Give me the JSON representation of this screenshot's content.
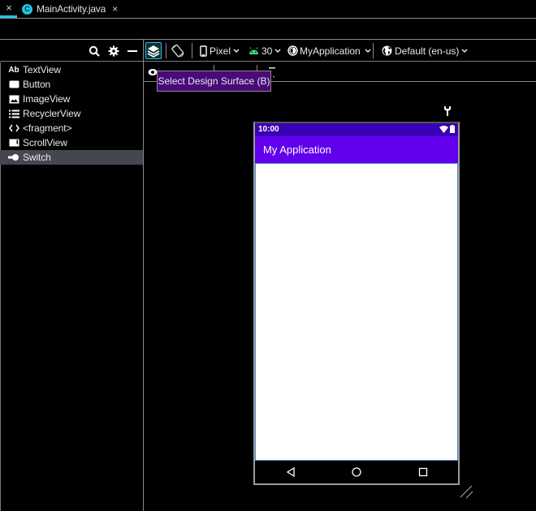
{
  "tabbar": {
    "active_tab": {
      "icon": "class-c-icon",
      "icon_letter": "C",
      "label": "MainActivity.java",
      "close": "×"
    },
    "left_close": "×"
  },
  "toolbar": {
    "search_icon": "search-icon",
    "settings_icon": "gear-icon",
    "minimize_icon": "minimize-icon",
    "design_surface_icon": "layers-icon",
    "orientation_icon": "rotate-device-icon",
    "device": {
      "label": "Pixel",
      "icon": "phone-icon"
    },
    "api": {
      "label": "30",
      "icon": "android-icon",
      "color": "#3ddc84"
    },
    "theme": {
      "label": "MyApplication",
      "icon": "theme-icon"
    },
    "locale": {
      "label": "Default (en-us)",
      "icon": "globe-icon"
    }
  },
  "tooltip": {
    "text": "Select Design Surface (B)"
  },
  "palette": {
    "items": [
      {
        "label": "TextView",
        "icon": "textview-icon",
        "glyph": "Ab",
        "selected": false
      },
      {
        "label": "Button",
        "icon": "button-icon",
        "glyph": "",
        "selected": false
      },
      {
        "label": "ImageView",
        "icon": "imageview-icon",
        "glyph": "",
        "selected": false
      },
      {
        "label": "RecyclerView",
        "icon": "list-icon",
        "glyph": "",
        "selected": false
      },
      {
        "label": "<fragment>",
        "icon": "code-brackets-icon",
        "glyph": "<>",
        "selected": false
      },
      {
        "label": "ScrollView",
        "icon": "scrollview-icon",
        "glyph": "",
        "selected": false
      },
      {
        "label": "Switch",
        "icon": "switch-icon",
        "glyph": "",
        "selected": true
      }
    ]
  },
  "device_preview": {
    "status_time": "10:00",
    "app_title": "My Application",
    "colors": {
      "status_bar": "#3a00b3",
      "app_bar": "#6200ee",
      "accent": "#1fc5e6"
    }
  }
}
